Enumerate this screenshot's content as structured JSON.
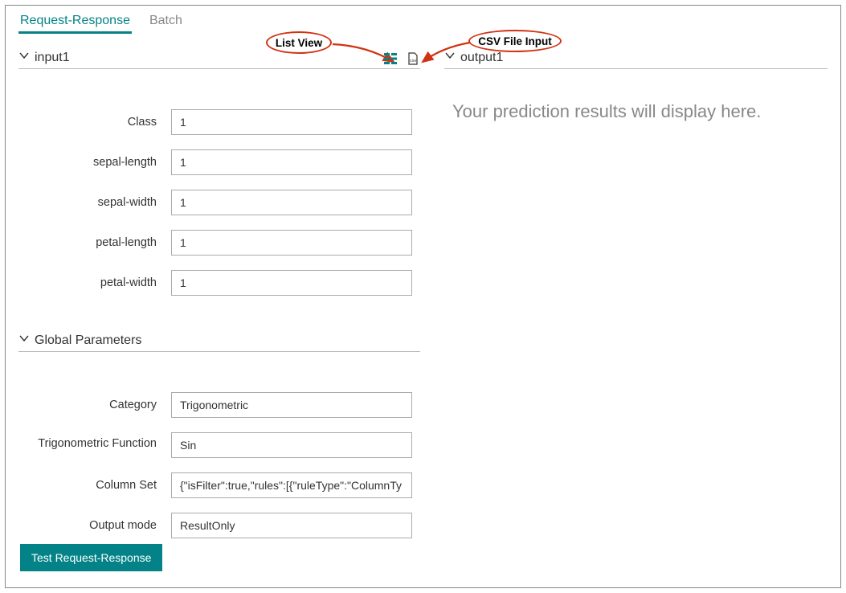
{
  "tabs": {
    "request_response": "Request-Response",
    "batch": "Batch"
  },
  "input_section": {
    "title": "input1",
    "fields": [
      {
        "label": "Class",
        "value": "1"
      },
      {
        "label": "sepal-length",
        "value": "1"
      },
      {
        "label": "sepal-width",
        "value": "1"
      },
      {
        "label": "petal-length",
        "value": "1"
      },
      {
        "label": "petal-width",
        "value": "1"
      }
    ]
  },
  "global_params": {
    "title": "Global Parameters",
    "fields": [
      {
        "label": "Category",
        "value": "Trigonometric"
      },
      {
        "label": "Trigonometric Function",
        "value": "Sin"
      },
      {
        "label": "Column Set",
        "value": "{\"isFilter\":true,\"rules\":[{\"ruleType\":\"ColumnTy"
      },
      {
        "label": "Output mode",
        "value": "ResultOnly"
      }
    ]
  },
  "output_section": {
    "title": "output1",
    "placeholder": "Your prediction results will display here."
  },
  "buttons": {
    "test": "Test Request-Response"
  },
  "callouts": {
    "list_view": "List View",
    "csv_file_input": "CSV File Input"
  },
  "icons": {
    "list_view": "list-view-icon",
    "csv_input": "csv-file-icon"
  },
  "colors": {
    "accent": "#038387",
    "annotation": "#d13212"
  }
}
